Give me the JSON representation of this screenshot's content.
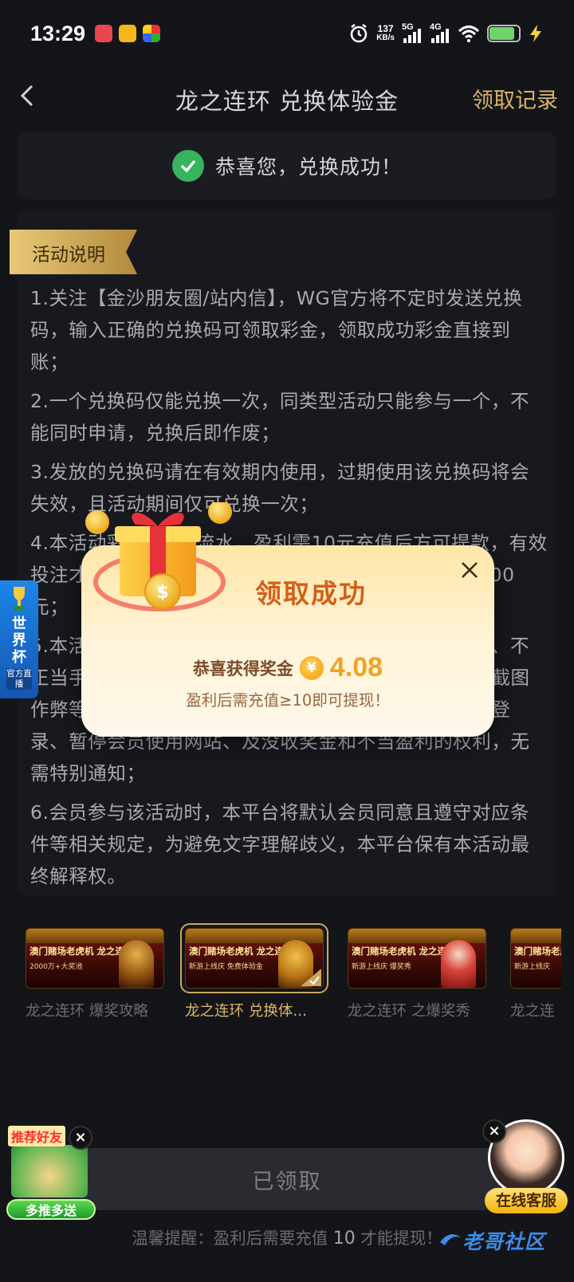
{
  "status_bar": {
    "time": "13:29",
    "net_speed_value": "137",
    "net_speed_unit": "KB/s",
    "net1": "5G",
    "net2": "4G",
    "battery_level": 0.85
  },
  "nav": {
    "title": "龙之连环 兑换体验金",
    "record_link": "领取记录"
  },
  "success": {
    "message": "恭喜您，兑换成功！"
  },
  "rules": {
    "tag": "活动说明",
    "items": [
      "1.关注【金沙朋友圈/站内信】，WG官方将不定时发送兑换码，输入正确的兑换码可领取彩金，领取成功彩金直接到账；",
      "2.一个兑换码仅能兑换一次，同类型活动只能参与一个，不能同时申请，兑换后即作废；",
      "3.发放的兑换码请在有效期内使用，过期使用该兑换码将会失效，且活动期间仅可兑换一次；",
      "4.本活动彩金需1倍流水，盈利需10元充值后方可提款，有效投注才能提现，同IP/设备仅限一次，彩金盈利上限为100元；",
      "5.本活动仅限同一会员参与，若发现会员使用多个账号、不正当手段、恶意套利、软件机器人、利用漏洞、接口、截图作弊等方式参与活动，一经发现，本平台有权终止会员登录、暂停会员使用网站、及没收奖金和不当盈利的权利，无需特别通知；",
      "6.会员参与该活动时，本平台将默认会员同意且遵守对应条件等相关规定，为避免文字理解歧义，本平台保有本活动最终解释权。"
    ]
  },
  "thumbs": [
    {
      "head": "澳门赌场老虎机 龙之连环",
      "sub": "2000万+大奖池",
      "caption": "龙之连环 爆奖攻略",
      "active": false
    },
    {
      "head": "澳门赌场老虎机 龙之连环",
      "sub": "新游上线庆 免费体验金",
      "caption": "龙之连环 兑换体...",
      "active": true
    },
    {
      "head": "澳门赌场老虎机 龙之连环",
      "sub": "新游上线庆 爆奖秀",
      "caption": "龙之连环  之爆奖秀",
      "active": false
    },
    {
      "head": "澳门赌场老虎机",
      "sub": "新游上线庆",
      "caption": "龙之连",
      "active": false
    }
  ],
  "bottom": {
    "claimed_button": "已领取",
    "tip_prefix": "温馨提醒：盈利后需要充值",
    "tip_amount": "10",
    "tip_suffix": "才能提现！"
  },
  "modal": {
    "title": "领取成功",
    "prize_label": "恭喜获得奖金",
    "yen_symbol": "¥",
    "amount": "4.08",
    "note": "盈利后需充值≥10即可提现！"
  },
  "worldcup": {
    "title": "世界杯",
    "sub": "官方直播"
  },
  "referral": {
    "top_label": "推荐好友",
    "button": "多推多送"
  },
  "service": {
    "label": "在线客服"
  },
  "watermark": {
    "text": "老哥社区"
  },
  "colors": {
    "accent_gold": "#d7b464",
    "success_green": "#38b45e",
    "modal_title": "#d55f18",
    "amount": "#f0a320"
  }
}
